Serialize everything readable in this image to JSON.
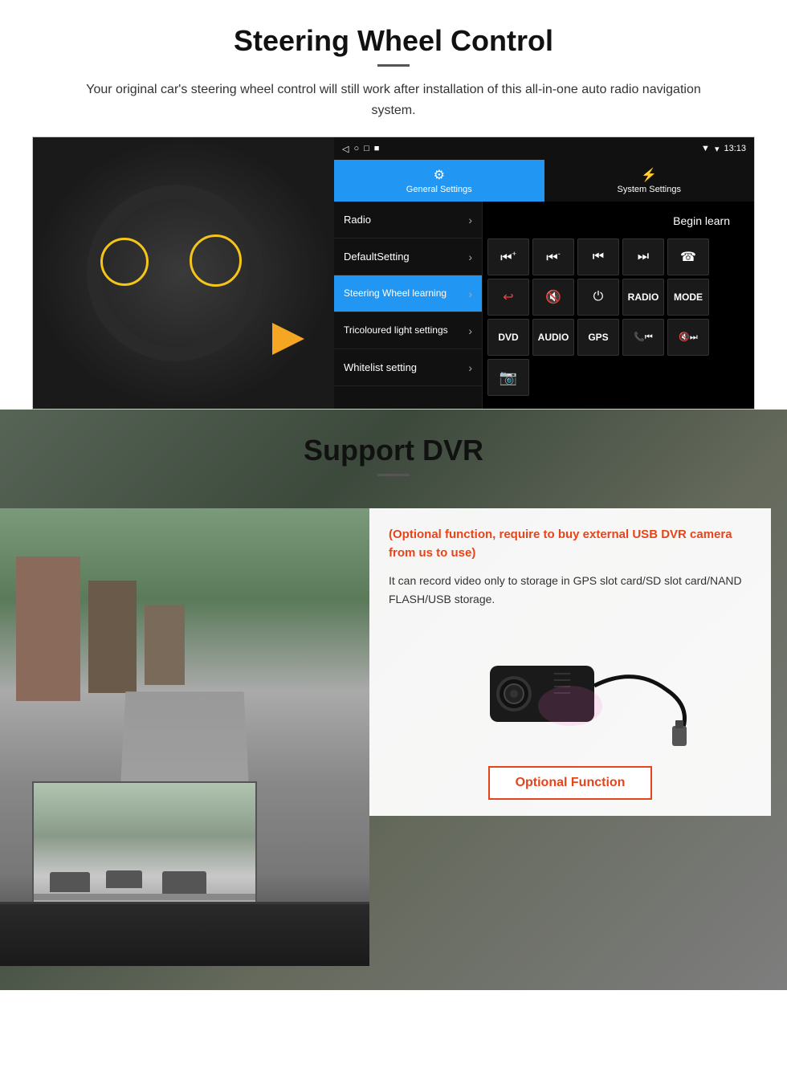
{
  "steering": {
    "title": "Steering Wheel Control",
    "subtitle": "Your original car's steering wheel control will still work after installation of this all-in-one auto radio navigation system.",
    "statusbar": {
      "time": "13:13",
      "signal": "▼",
      "wifi": "▾"
    },
    "nav_icons": [
      "◁",
      "○",
      "□",
      "■"
    ],
    "tabs": [
      {
        "label": "General Settings",
        "icon": "⚙",
        "active": true
      },
      {
        "label": "System Settings",
        "icon": "⚡",
        "active": false
      }
    ],
    "menu_items": [
      {
        "label": "Radio",
        "active": false
      },
      {
        "label": "DefaultSetting",
        "active": false
      },
      {
        "label": "Steering Wheel learning",
        "active": true
      },
      {
        "label": "Tricoloured light settings",
        "active": false
      },
      {
        "label": "Whitelist setting",
        "active": false
      }
    ],
    "begin_learn": "Begin learn",
    "control_buttons": [
      [
        "⏮+",
        "⏮-",
        "⏮|",
        "|⏭",
        "☎"
      ],
      [
        "↩",
        "🔇",
        "⏻",
        "RADIO",
        "MODE"
      ],
      [
        "DVD",
        "AUDIO",
        "GPS",
        "📞⏮|",
        "🔇⏭|"
      ]
    ]
  },
  "dvr": {
    "title": "Support DVR",
    "optional_text": "(Optional function, require to buy external USB DVR camera from us to use)",
    "description": "It can record video only to storage in GPS slot card/SD slot card/NAND FLASH/USB storage.",
    "optional_btn": "Optional Function"
  }
}
